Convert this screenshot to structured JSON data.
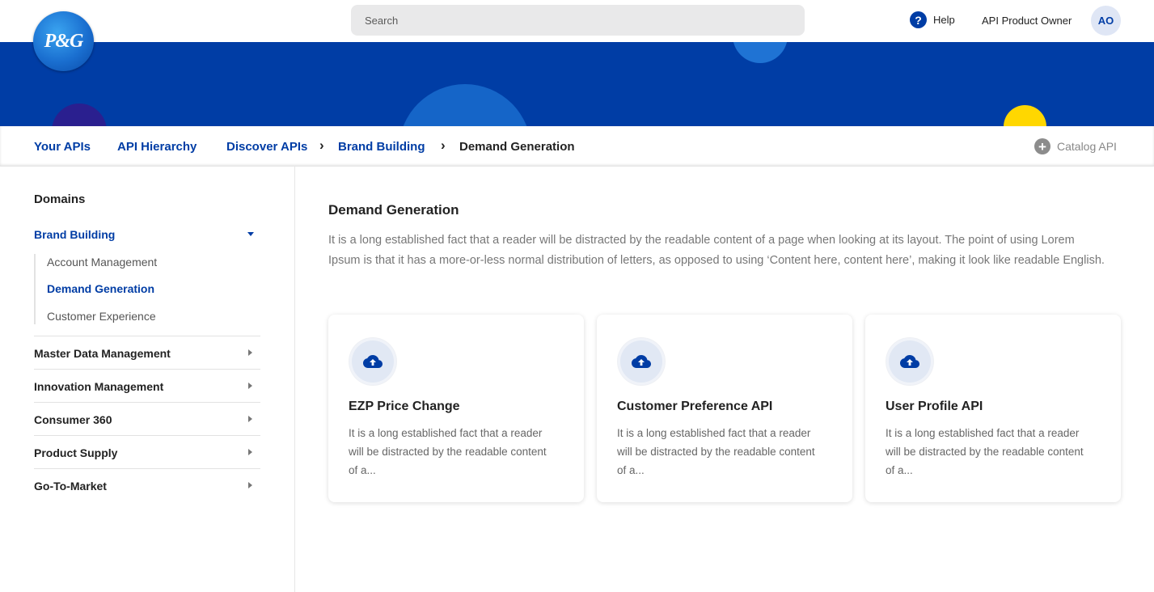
{
  "header": {
    "search_placeholder": "Search",
    "help_label": "Help",
    "user_name": "API Product Owner",
    "user_initials": "AO",
    "logo_text": "P&G"
  },
  "breadcrumb": {
    "your_apis": "Your APIs",
    "api_hierarchy": "API Hierarchy",
    "discover_apis": "Discover APIs",
    "brand_building": "Brand Building",
    "current": "Demand Generation",
    "separator": "›",
    "catalog_api": "Catalog API"
  },
  "sidebar": {
    "title": "Domains",
    "expanded": {
      "label": "Brand Building",
      "children": [
        {
          "label": "Account Management"
        },
        {
          "label": "Demand Generation",
          "active": true
        },
        {
          "label": "Customer Experience"
        }
      ]
    },
    "collapsed": [
      {
        "label": "Master Data Management"
      },
      {
        "label": "Innovation Management"
      },
      {
        "label": "Consumer 360"
      },
      {
        "label": "Product Supply"
      },
      {
        "label": "Go-To-Market"
      }
    ]
  },
  "main": {
    "title": "Demand Generation",
    "description": "It is a long established fact that a reader will be distracted by the readable content of a page when looking at its layout. The point of using Lorem Ipsum is that it has a more-or-less normal distribution of letters, as opposed to using ‘Content here, content here’, making it look like readable English.",
    "cards": [
      {
        "title": "EZP Price Change",
        "description": "It is a long established fact that a reader will be distracted by the readable content of a...",
        "icon": "cloud-upload-icon"
      },
      {
        "title": "Customer Preference API",
        "description": "It is a long established fact that a reader will be distracted by the readable content of a...",
        "icon": "cloud-upload-icon"
      },
      {
        "title": "User Profile API",
        "description": "It is a long established fact that a reader will be distracted by the readable content of a...",
        "icon": "cloud-upload-icon"
      }
    ]
  },
  "colors": {
    "brand_blue": "#003da5",
    "banner_circle_dark": "#2a1f8f",
    "banner_circle_mid": "#1565c8",
    "banner_circle_yellow": "#ffd700"
  }
}
